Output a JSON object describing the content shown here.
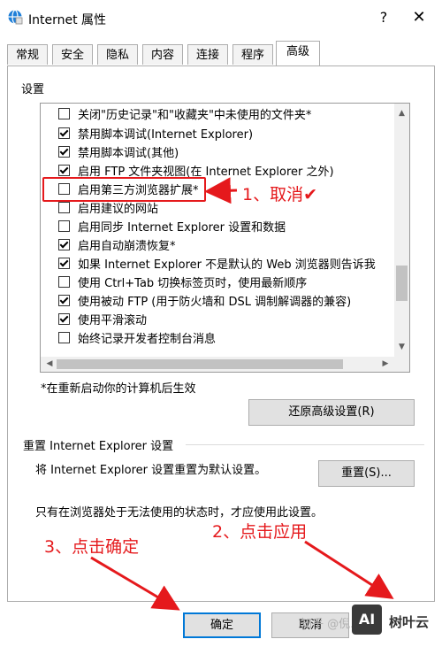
{
  "window": {
    "title": "Internet 属性",
    "help_label": "?",
    "close_label": "✕"
  },
  "tabs": [
    {
      "label": "常规"
    },
    {
      "label": "安全"
    },
    {
      "label": "隐私"
    },
    {
      "label": "内容"
    },
    {
      "label": "连接"
    },
    {
      "label": "程序"
    },
    {
      "label": "高级",
      "active": true
    }
  ],
  "settings": {
    "label": "设置",
    "items": [
      {
        "label": "关闭\"历史记录\"和\"收藏夹\"中未使用的文件夹*",
        "checked": false
      },
      {
        "label": "禁用脚本调试(Internet Explorer)",
        "checked": true
      },
      {
        "label": "禁用脚本调试(其他)",
        "checked": true
      },
      {
        "label": "启用 FTP 文件夹视图(在 Internet Explorer 之外)",
        "checked": true
      },
      {
        "label": "启用第三方浏览器扩展*",
        "checked": false
      },
      {
        "label": "启用建议的网站",
        "checked": false
      },
      {
        "label": "启用同步 Internet Explorer 设置和数据",
        "checked": false
      },
      {
        "label": "启用自动崩溃恢复*",
        "checked": true
      },
      {
        "label": "如果 Internet Explorer 不是默认的 Web 浏览器则告诉我",
        "checked": true
      },
      {
        "label": "使用 Ctrl+Tab 切换标签页时，使用最新顺序",
        "checked": false
      },
      {
        "label": "使用被动 FTP (用于防火墙和 DSL 调制解调器的兼容)",
        "checked": true
      },
      {
        "label": "使用平滑滚动",
        "checked": true
      },
      {
        "label": "始终记录开发者控制台消息",
        "checked": false
      }
    ],
    "restart_note": "*在重新启动你的计算机后生效",
    "restore_button": "还原高级设置(R)"
  },
  "reset": {
    "group_label": "重置 Internet Explorer 设置",
    "description": "将 Internet Explorer 设置重置为默认设置。",
    "button": "重置(S)...",
    "note": "只有在浏览器处于无法使用的状态时，才应使用此设置。"
  },
  "footer": {
    "ok": "确定",
    "cancel": "取消"
  },
  "annotations": {
    "step1": "1、取消✔",
    "step2": "2、点击应用",
    "step3": "3、点击确定",
    "color": "#e5191c"
  },
  "watermark": {
    "text": "知乎 @倪...",
    "logo": "AI",
    "brand": "树叶云"
  }
}
